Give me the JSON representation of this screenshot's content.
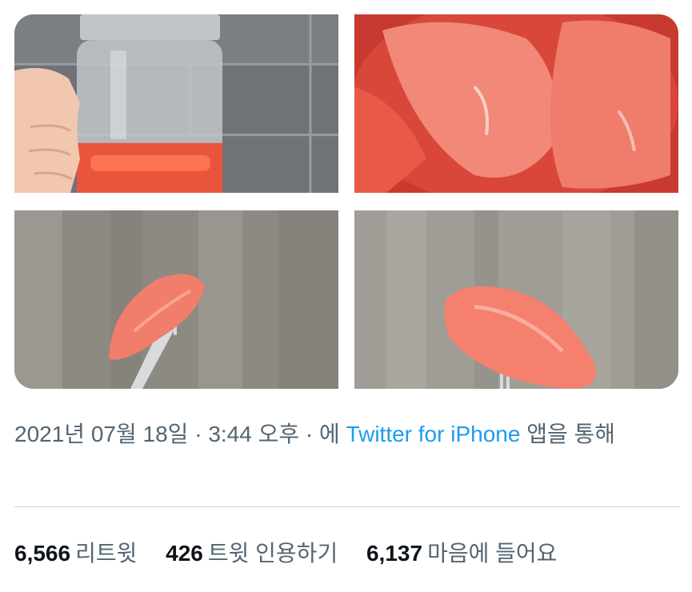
{
  "tweet": {
    "photos": [
      {
        "name": "jar-held-by-hand"
      },
      {
        "name": "jar-closeup-pickles"
      },
      {
        "name": "pickle-on-fork-left"
      },
      {
        "name": "pickle-on-fork-right"
      }
    ],
    "meta": {
      "date": "2021년 07월 18일",
      "sep1": " · ",
      "time": "3:44 오후",
      "sep2": " · ",
      "via_prefix": "에 ",
      "source": "Twitter for iPhone",
      "via_suffix": " 앱을 통해"
    },
    "stats": [
      {
        "count": "6,566",
        "label": "리트윗"
      },
      {
        "count": "426",
        "label": "트윗 인용하기"
      },
      {
        "count": "6,137",
        "label": "마음에 들어요"
      }
    ]
  }
}
